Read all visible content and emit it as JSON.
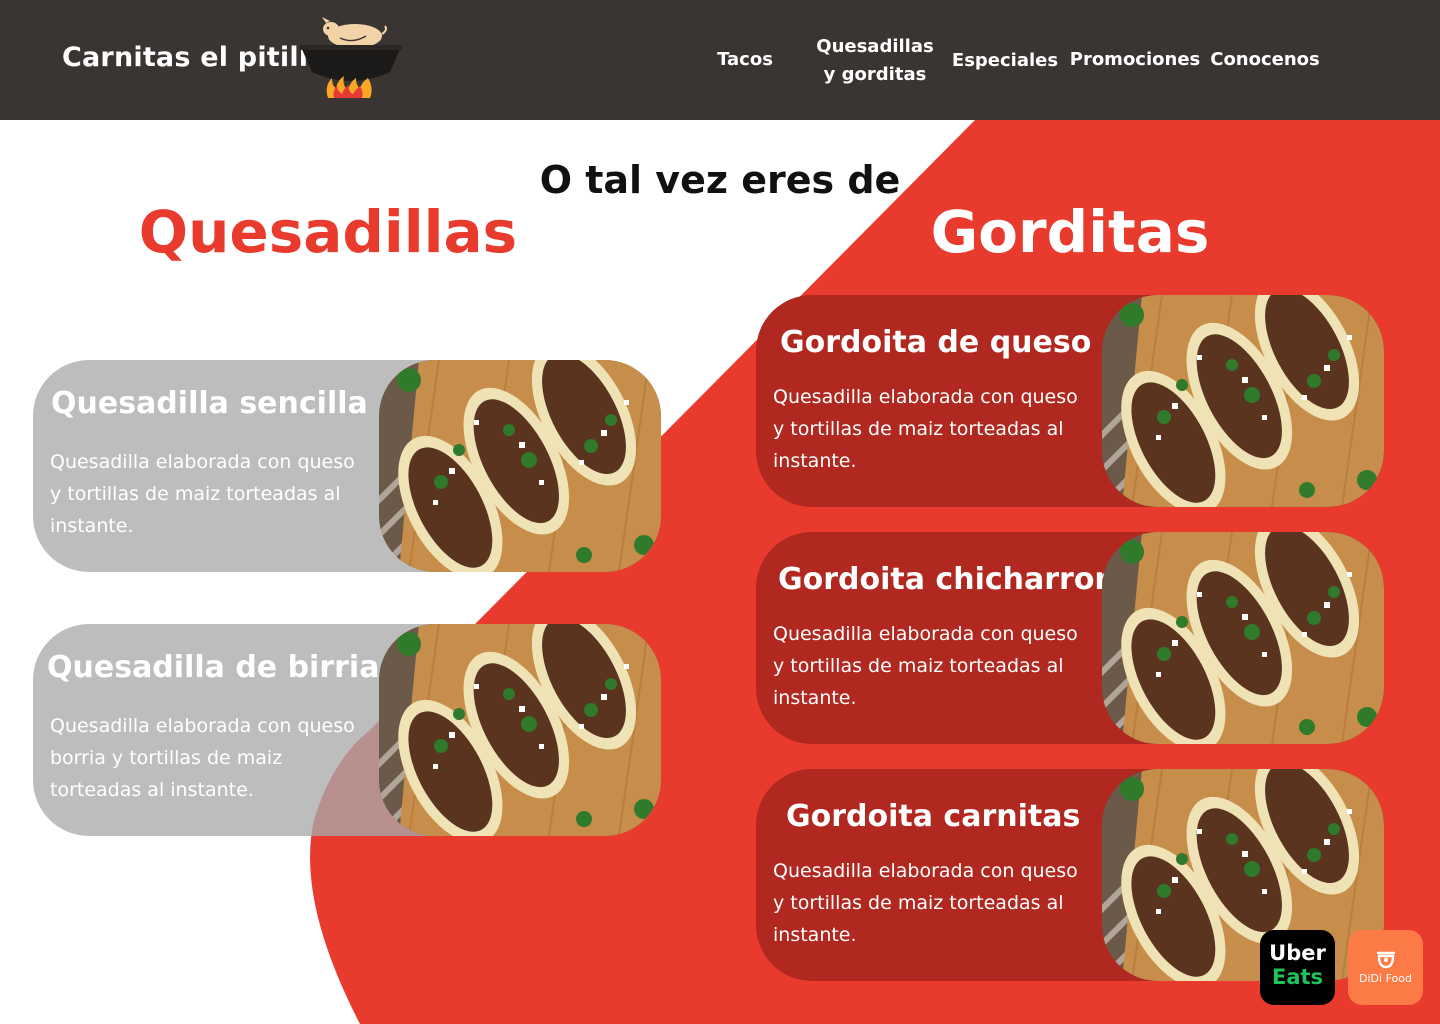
{
  "brand": {
    "name": "Carnitas el pitilla"
  },
  "nav": [
    {
      "label": "Tacos"
    },
    {
      "label": "Quesadillas",
      "label2": "y gorditas"
    },
    {
      "label": "Especiales"
    },
    {
      "label": "Promociones"
    },
    {
      "label": "Conocenos"
    }
  ],
  "intro": "O tal vez eres de",
  "sections": {
    "quesadillas": {
      "title": "Quesadillas",
      "items": [
        {
          "title": "Quesadilla sencilla",
          "description": "Quesadilla elaborada con queso y tortillas de maiz  torteadas al instante."
        },
        {
          "title": "Quesadilla de birria",
          "description": "Quesadilla elaborada con queso borria y tortillas de maiz torteadas al instante."
        }
      ]
    },
    "gorditas": {
      "title": "Gorditas",
      "items": [
        {
          "title": "Gordoita de queso",
          "description": "Quesadilla elaborada con queso y tortillas de maiz  torteadas al instante."
        },
        {
          "title": "Gordoita chicharron",
          "description": "Quesadilla elaborada con queso y tortillas de maiz  torteadas al instante."
        },
        {
          "title": "Gordoita carnitas",
          "description": "Quesadilla elaborada con queso y tortillas de maiz  torteadas al instante."
        }
      ]
    }
  },
  "delivery": {
    "uber": {
      "line1": "Uber",
      "line2": "Eats",
      "icon": "uber-eats-logo"
    },
    "didi": {
      "label": "DiDi Food",
      "icon": "didi-food-logo"
    }
  },
  "colors": {
    "header_bg": "#3a3532",
    "accent_red": "#e83a2d",
    "card_dark": "#b0281f",
    "card_grey": "#aaaaaa",
    "uber_green": "#1fc25b",
    "didi_orange": "#fc7a46"
  }
}
